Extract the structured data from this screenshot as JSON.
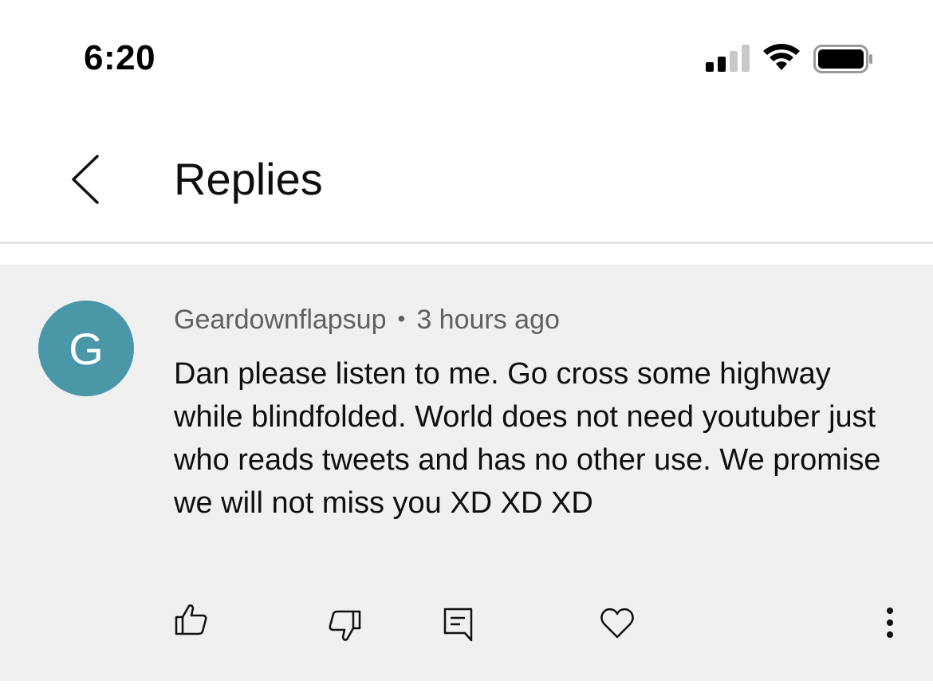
{
  "status_bar": {
    "time": "6:20"
  },
  "header": {
    "title": "Replies"
  },
  "comment": {
    "avatar_letter": "G",
    "avatar_color": "#4a97a8",
    "author": "Geardownflapsup",
    "separator": "•",
    "timestamp": "3 hours ago",
    "text": "Dan please listen to me. Go cross some highway while blindfolded. World does not need youtuber just who reads tweets and has no other use. We promise we will not miss you XD XD XD"
  },
  "icons": {
    "back": "chevron-left-icon",
    "like": "thumbs-up-icon",
    "dislike": "thumbs-down-icon",
    "reply": "comment-icon",
    "heart": "heart-icon",
    "more": "more-vertical-icon"
  },
  "colors": {
    "card_background": "#f0f0f0",
    "meta_text": "#606060"
  }
}
